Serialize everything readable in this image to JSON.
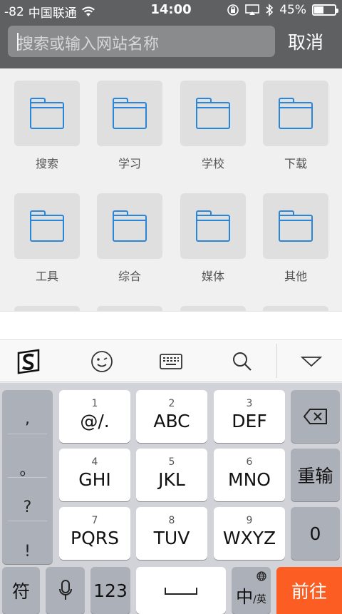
{
  "status_bar": {
    "signal": "-82",
    "carrier": "中国联通",
    "time": "14:00",
    "battery_text": "45%",
    "battery_level": 0.45
  },
  "search": {
    "placeholder": "搜索或输入网站名称",
    "cancel_label": "取消"
  },
  "folders": [
    {
      "label": "搜索"
    },
    {
      "label": "学习"
    },
    {
      "label": "学校"
    },
    {
      "label": "下载"
    },
    {
      "label": "工具"
    },
    {
      "label": "综合"
    },
    {
      "label": "媒体"
    },
    {
      "label": "其他"
    }
  ],
  "keyboard": {
    "toolbar_icons": [
      "sogou-logo-icon",
      "emoji-icon",
      "keyboard-icon",
      "search-icon",
      "collapse-keyboard-icon"
    ],
    "punctuation": [
      ",",
      "。",
      "?",
      "!"
    ],
    "keys": [
      {
        "num": "1",
        "letters": "@/."
      },
      {
        "num": "2",
        "letters": "ABC"
      },
      {
        "num": "3",
        "letters": "DEF"
      },
      {
        "num": "4",
        "letters": "GHI"
      },
      {
        "num": "5",
        "letters": "JKL"
      },
      {
        "num": "6",
        "letters": "MNO"
      },
      {
        "num": "7",
        "letters": "PQRS"
      },
      {
        "num": "8",
        "letters": "TUV"
      },
      {
        "num": "9",
        "letters": "WXYZ"
      }
    ],
    "reenter_label": "重输",
    "zero_label": "0",
    "symbols_label": "符",
    "numbers_label": "123",
    "lang_main": "中",
    "lang_sub": "/英",
    "go_label": "前往"
  },
  "colors": {
    "header_bg": "#5f6061",
    "folder_blue": "#2b86d8",
    "go_orange": "#fb5d23"
  }
}
